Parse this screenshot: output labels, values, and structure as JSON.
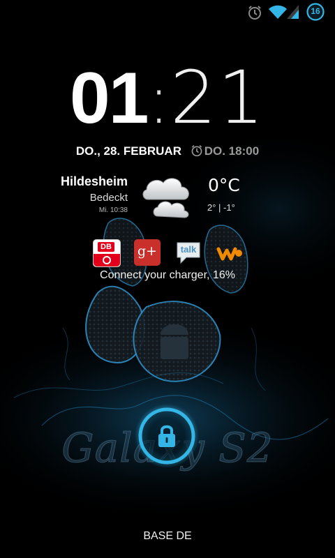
{
  "status_bar": {
    "notification_badge": "16",
    "icons": [
      "alarm-icon",
      "wifi-icon",
      "signal-icon"
    ]
  },
  "clock": {
    "hours": "01",
    "separator": ":",
    "minutes": "21"
  },
  "date_row": {
    "date": "DO., 28. FEBRUAR",
    "alarm": "DO. 18:00"
  },
  "weather": {
    "city": "Hildesheim",
    "condition": "Bedeckt",
    "updated": "Mi. 10:38",
    "temperature": "0°C",
    "range": "2° | -1°",
    "icon": "cloudy-icon"
  },
  "apps": [
    {
      "name": "db-app-icon",
      "label": "DB"
    },
    {
      "name": "google-plus-icon",
      "label": "g+"
    },
    {
      "name": "talk-icon",
      "label": "talk"
    },
    {
      "name": "walkman-icon",
      "label": "W"
    }
  ],
  "charger_text": "Connect your charger, 16%",
  "wallpaper_text": "Galaxy S2",
  "carrier": "BASE DE",
  "colors": {
    "accent": "#33b5e5",
    "ring": "#1aa7e6"
  }
}
